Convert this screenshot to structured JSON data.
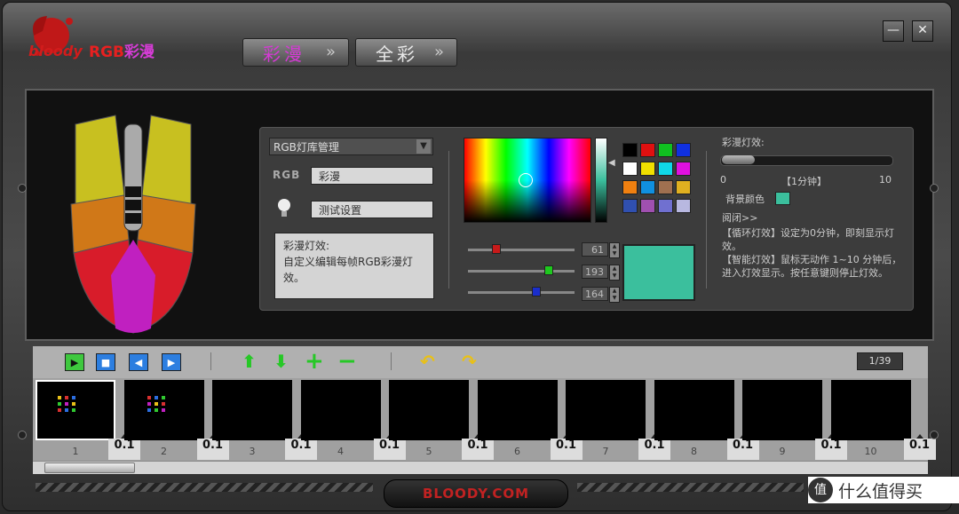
{
  "app": {
    "logo_text": "bloody",
    "title_rgb": "RGB",
    "title_rest": "彩漫",
    "tabs": [
      {
        "label": "彩漫",
        "active": true
      },
      {
        "label": "全彩",
        "active": false
      }
    ],
    "win_buttons": {
      "minimize": "—",
      "close": "✕"
    }
  },
  "left_panel": {
    "library_select": "RGB灯库管理",
    "rgb_tag": "RGB",
    "effect_name": "彩漫",
    "test_setting": "测试设置",
    "description": "彩漫灯效:\n自定义编辑每帧RGB彩漫灯效。"
  },
  "color_picker": {
    "swatches": [
      "#000000",
      "#e01010",
      "#10c020",
      "#1030e0",
      "#ffffff",
      "#f0e000",
      "#10d8e8",
      "#e010e0",
      "#f08010",
      "#1090e0",
      "#a07050",
      "#e0b020",
      "#3050b0",
      "#a050b0",
      "#7070d0",
      "#b8b8e0"
    ],
    "sliders": [
      {
        "name": "red",
        "value": "61",
        "color": "#c81a1a",
        "pos": 0.27
      },
      {
        "name": "green",
        "value": "193",
        "color": "#1ec81e",
        "pos": 0.76
      },
      {
        "name": "blue",
        "value": "164",
        "color": "#1a2ecc",
        "pos": 0.64
      }
    ],
    "selected_color": "#3bbf9d"
  },
  "right_panel": {
    "speed_label": "彩漫灯效:",
    "scale_min": "0",
    "scale_mid": "【1分钟】",
    "scale_max": "10",
    "bg_color_label": "背景颜色",
    "bg_color": "#3bbf9d",
    "read_toggle": "阅闭>>",
    "info1": "【循环灯效】设定为0分钟，即刻显示灯效。",
    "info2": "【智能灯效】鼠标无动作 1~10 分钟后，进入灯效显示。按任意键则停止灯效。"
  },
  "toolbar": {
    "play": "▶",
    "stop": "■",
    "prev": "◀",
    "next": "▶",
    "up": "⬆",
    "down": "⬇",
    "add": "+",
    "remove": "−",
    "undo": "↶",
    "redo": "↷",
    "page": "1/39"
  },
  "frames": [
    {
      "label": "1",
      "dur": "0.1",
      "selected": true
    },
    {
      "label": "2",
      "dur": "0.1"
    },
    {
      "label": "3",
      "dur": "0.1"
    },
    {
      "label": "4",
      "dur": "0.1"
    },
    {
      "label": "5",
      "dur": "0.1"
    },
    {
      "label": "6",
      "dur": "0.1"
    },
    {
      "label": "7",
      "dur": "0.1"
    },
    {
      "label": "8",
      "dur": "0.1"
    },
    {
      "label": "9",
      "dur": "0.1"
    },
    {
      "label": "10",
      "dur": "0.1"
    }
  ],
  "footer": {
    "brand": "BLOODY.COM",
    "watermark_icon": "值",
    "watermark_text": "什么值得买"
  }
}
